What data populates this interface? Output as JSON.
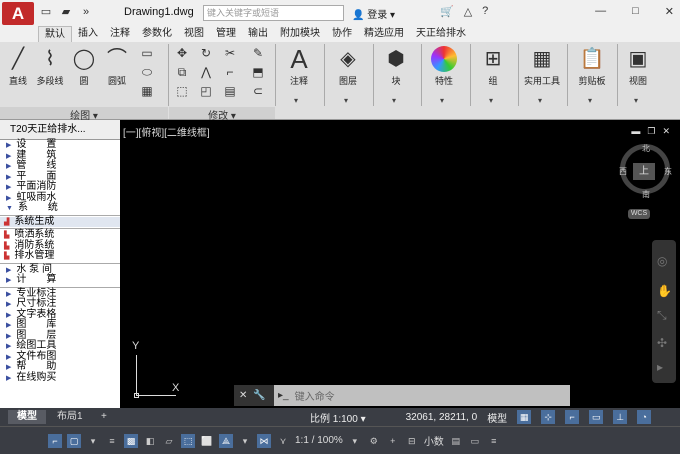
{
  "titlebar": {
    "app_button": "A",
    "doc_title": "Drawing1.dwg",
    "search_placeholder": "键入关键字或短语",
    "login": "登录",
    "window_controls": [
      "—",
      "□",
      "✕"
    ]
  },
  "ribbon_tabs": [
    "默认",
    "插入",
    "注释",
    "参数化",
    "视图",
    "管理",
    "输出",
    "附加模块",
    "协作",
    "精选应用",
    "天正给排水"
  ],
  "ribbon": {
    "draw_buttons": [
      "直线",
      "多段线",
      "圆",
      "圆弧"
    ],
    "draw_label": "绘图",
    "modify_label": "修改",
    "annotate": "注释",
    "layers": "图层",
    "block": "块",
    "properties": "特性",
    "group": "组",
    "utilities": "实用工具",
    "clipboard": "剪贴板",
    "view": "视图"
  },
  "left_panel": {
    "header": "T20天正给排水...",
    "group1": [
      "设　　置",
      "建　　筑",
      "管　　线",
      "平　　面",
      "平面消防",
      "虹吸雨水",
      "系　　统"
    ],
    "group2": [
      "系统生成",
      "喷洒系统",
      "消防系统",
      "排水管理"
    ],
    "group3": [
      "水 泵 间",
      "计　　算"
    ],
    "group4": [
      "专业标注",
      "尺寸标注",
      "文字表格",
      "图　　库",
      "图　　层",
      "绘图工具",
      "文件布图",
      "帮　　助",
      "在线购买"
    ]
  },
  "canvas": {
    "view_label": "[一][俯视][二维线框]",
    "compass": {
      "n": "北",
      "s": "南",
      "e": "东",
      "w": "西",
      "cube": "上"
    },
    "wcs": "WCS",
    "ucs_y": "Y",
    "ucs_x": "X"
  },
  "cmdline": {
    "prompt": "键入命令"
  },
  "layout_tabs": [
    "模型",
    "布局1",
    "+"
  ],
  "status": {
    "scale": "比例 1:100",
    "coords": "32061, 28211, 0",
    "model": "模型",
    "annot_scale": "1:1 / 100%",
    "units": "小数"
  }
}
